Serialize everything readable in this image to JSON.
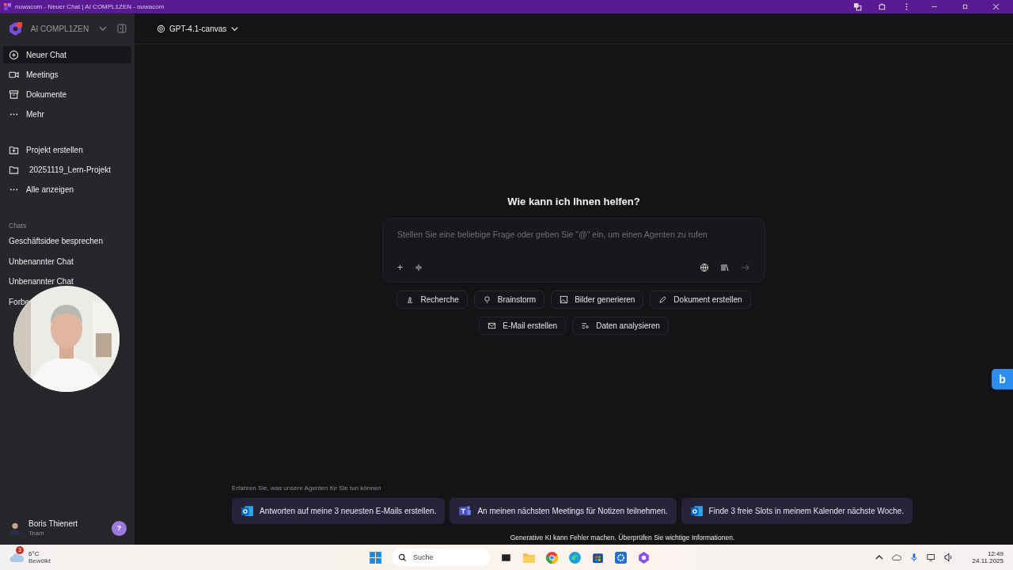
{
  "window": {
    "title": "nuwacom - Neuer Chat | AI COMPL1ZEN - nuwacom"
  },
  "sidebar": {
    "brand": "AI COMPL1ZEN",
    "nav": [
      {
        "label": "Neuer Chat",
        "selected": true
      },
      {
        "label": "Meetings",
        "selected": false
      },
      {
        "label": "Dokumente",
        "selected": false
      },
      {
        "label": "Mehr",
        "selected": false
      }
    ],
    "projects": [
      {
        "label": "Projekt erstellen"
      },
      {
        "label": "20251119_Lern-Projekt"
      },
      {
        "label": "Alle anzeigen"
      }
    ],
    "chats_heading": "Chats",
    "chats": [
      "Geschäftsidee besprechen",
      "Unbenannter Chat",
      "Unbenannter Chat",
      "Forbe"
    ],
    "user": {
      "name": "Boris Thienert",
      "role": "Team"
    },
    "help": "?"
  },
  "model": "GPT-4.1-canvas",
  "heading": "Wie kann ich Ihnen helfen?",
  "prompt": {
    "placeholder": "Stellen Sie eine beliebige Frage oder geben Sie \"@\" ein, um einen Agenten zu rufen",
    "add": "+"
  },
  "actions": [
    [
      "Recherche",
      "Brainstorm",
      "Bilder generieren",
      "Dokument erstellen"
    ],
    [
      "E-Mail erstellen",
      "Daten analysieren"
    ]
  ],
  "agents_heading": "Erfahren Sie, was unsere Agenten für Sie tun können",
  "agents": [
    {
      "kind": "outlook",
      "label": "Antworten auf meine 3 neuesten E-Mails erstellen."
    },
    {
      "kind": "teams",
      "label": "An meinen nächsten Meetings für Notizen teilnehmen."
    },
    {
      "kind": "outlook",
      "label": "Finde 3 freie Slots in meinem Kalender nächste Woche."
    }
  ],
  "disclaimer": "Generative KI kann Fehler machen. Überprüfen Sie wichtige Informationen.",
  "side_tab": "b",
  "webcam": {
    "kind": "picture"
  },
  "taskbar": {
    "weather": {
      "temp": "6°C",
      "desc": "Bewölkt",
      "badge": "3"
    },
    "search": "Suche",
    "time": "12:49",
    "date": "24.11.2025"
  }
}
